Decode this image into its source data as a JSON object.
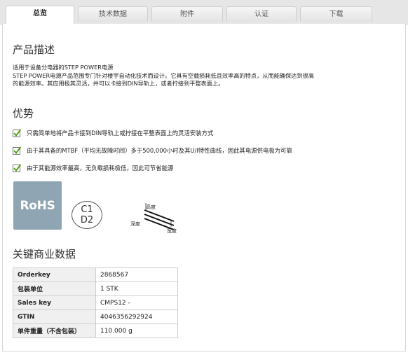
{
  "tabs": [
    {
      "label": "总览",
      "active": true
    },
    {
      "label": "技术数据",
      "active": false
    },
    {
      "label": "附件",
      "active": false
    },
    {
      "label": "认证",
      "active": false
    },
    {
      "label": "下载",
      "active": false
    }
  ],
  "product_description": {
    "heading": "产品描述",
    "lines": [
      "适用于设备分电器的STEP POWER电源",
      "STEP POWER电源产品范围专门针对楼宇自动化技术而设计。它具有空载损耗低且效率高的特点，从而能确保达到很高",
      "的能源效率。其应用极其灵活，并可以卡接到DIN导轨上，或者拧接到平整表面上。"
    ]
  },
  "advantages": {
    "heading": "优势",
    "items": [
      "只需简单地将产品卡接到DIN导轨上或拧接在平整表面上的灵活安装方式",
      "由于其具备的MTBF（平均无故障时间）多于500,000小时及其U/I特性曲线，因此其电源供电极为可靠",
      "由于其能源效率最高，无负载损耗极低，因此可节省能源"
    ]
  },
  "badges": {
    "rohs": "RoHS",
    "c1": "C1",
    "d2": "D2",
    "height_label": "高度",
    "depth_label": "深度",
    "width_label": "宽度"
  },
  "key_data": {
    "heading": "关键商业数据",
    "rows": [
      {
        "key": "Orderkey",
        "value": "2868567"
      },
      {
        "key": "包装单位",
        "value": "1 STK"
      },
      {
        "key": "Sales key",
        "value": "CMPS12 -"
      },
      {
        "key": "GTIN",
        "value": "4046356292924"
      },
      {
        "key": "单件重量（不含包装）",
        "value": "110.000 g"
      }
    ]
  },
  "colors": {
    "check_green": "#5a9e1e",
    "rohs_bg": "#8fa5b4"
  }
}
